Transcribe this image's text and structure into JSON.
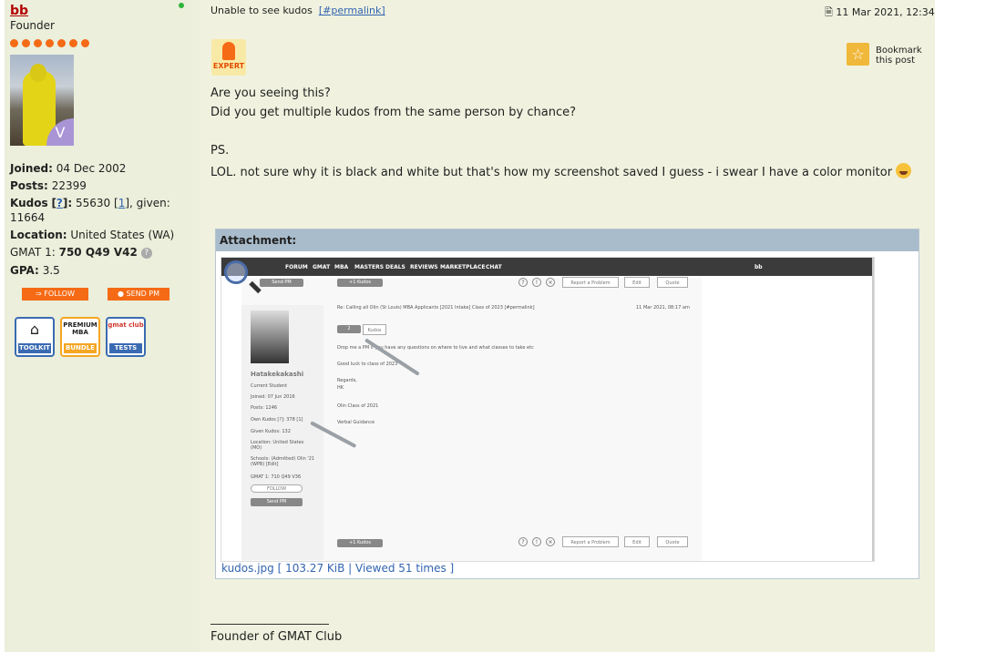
{
  "user": {
    "name": "bb",
    "rank": "Founder",
    "avatar_badge": "V",
    "joined_label": "Joined:",
    "joined": "04 Dec 2002",
    "posts_label": "Posts:",
    "posts": "22399",
    "kudos_label": "Kudos",
    "kudos_help": "?",
    "kudos_value": "55630",
    "kudos_link": "1",
    "kudos_given_prefix": ", given:",
    "kudos_given": "11664",
    "location_label": "Location:",
    "location": "United States (WA)",
    "gmat_label": "GMAT 1:",
    "gmat": "750 Q49 V42",
    "gpa_label": "GPA:",
    "gpa": "3.5",
    "follow_button": "FOLLOW",
    "send_pm_button": "SEND PM",
    "badges": [
      {
        "top": "",
        "bottom": "TOOLKIT"
      },
      {
        "top": "PREMIUM MBA",
        "bottom": "BUNDLE"
      },
      {
        "top": "gmat club",
        "bottom": "TESTS"
      }
    ]
  },
  "post": {
    "title": "Unable to see kudos",
    "permalink": "[#permalink]",
    "date": "11 Mar 2021, 12:34",
    "expert_label": "EXPERT",
    "bookmark_label": "Bookmark this post",
    "lines": [
      "Are you seeing this?",
      "Did you get multiple kudos from the same person by chance?",
      "PS.",
      "LOL. not sure why it is black and white but that's how my screenshot saved I guess - i swear I have a color monitor"
    ],
    "attachment_header": "Attachment:",
    "attachment_caption": "kudos.jpg [ 103.27 KiB | Viewed 51 times ]",
    "signature": "Founder of GMAT Club"
  },
  "screenshot": {
    "nav_items": [
      "FORUM",
      "GMAT",
      "MBA",
      "MASTERS",
      "DEALS",
      "REVIEWS",
      "MARKETPLACE",
      "CHAT"
    ],
    "nav_user": "bb",
    "send_pm": "Send PM",
    "kudos_btn": "+1 Kudos",
    "report": "Report a Problem",
    "edit": "Edit",
    "quote": "Quote",
    "post_title": "Re: Calling all Olin (St Louis) MBA Applicants [2021 Intake] Class of 2023 [#permalink]",
    "post_date": "11 Mar 2021, 08:17 am",
    "kudos_count": "2",
    "kudos_word": "Kudos",
    "username": "Hatakekakashi",
    "user_status": "Current Student",
    "joined": "Joined: 07 Jun 2016",
    "posts": "Posts: 1246",
    "own_kudos": "Own Kudos [?]: 378 [1]",
    "given_kudos": "Given Kudos: 132",
    "location": "Location: United States (MO)",
    "schools": "Schools: (Admitted) Olin '21 (WPB) [Edit]",
    "gmat": "GMAT 1: 710 Q49 V36",
    "follow": "FOLLOW",
    "body1": "Drop me a PM if you have any questions on where to live and what classes to take etc",
    "body2": "Good luck to class of 2023",
    "body3": "Regards,",
    "body4": "HK",
    "body5": "Olin Class of 2021",
    "body6": "Verbal Guidance"
  }
}
